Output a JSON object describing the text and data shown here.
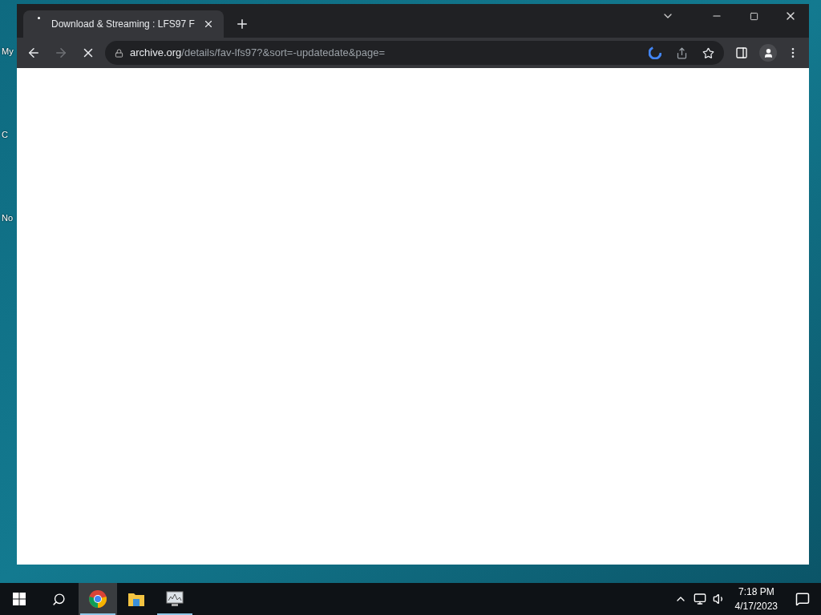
{
  "desktop_icons": [
    {
      "label": "My"
    },
    {
      "label": "C"
    },
    {
      "label": "No"
    }
  ],
  "browser": {
    "tab": {
      "title": "Download & Streaming : LFS97 F",
      "loading": true
    },
    "url": {
      "host": "archive.org",
      "path": "/details/fav-lfs97?&sort=-updatedate&page="
    },
    "forward_disabled": true,
    "bookmarked": false
  },
  "taskbar": {
    "apps": [
      {
        "kind": "chrome",
        "selected": true,
        "running": true
      },
      {
        "kind": "folder",
        "selected": false,
        "running": false
      },
      {
        "kind": "monitor",
        "selected": false,
        "running": true
      }
    ],
    "time": "7:18 PM",
    "date": "4/17/2023"
  }
}
